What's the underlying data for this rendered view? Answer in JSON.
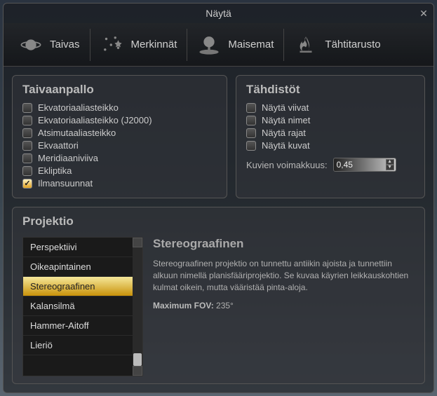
{
  "title": "Näytä",
  "tabs": [
    {
      "label": "Taivas"
    },
    {
      "label": "Merkinnät"
    },
    {
      "label": "Maisemat"
    },
    {
      "label": "Tähtitarusto"
    }
  ],
  "sky": {
    "title": "Taivaanpallo",
    "items": [
      {
        "label": "Ekvatoriaaliasteikko",
        "checked": false
      },
      {
        "label": "Ekvatoriaaliasteikko (J2000)",
        "checked": false
      },
      {
        "label": "Atsimutaaliasteikko",
        "checked": false
      },
      {
        "label": "Ekvaattori",
        "checked": false
      },
      {
        "label": "Meridiaaniviiva",
        "checked": false
      },
      {
        "label": "Ekliptika",
        "checked": false
      },
      {
        "label": "Ilmansuunnat",
        "checked": true
      }
    ]
  },
  "constellations": {
    "title": "Tähdistöt",
    "items": [
      {
        "label": "Näytä viivat",
        "checked": false
      },
      {
        "label": "Näytä nimet",
        "checked": false
      },
      {
        "label": "Näytä rajat",
        "checked": false
      },
      {
        "label": "Näytä kuvat",
        "checked": false
      }
    ],
    "brightness_label": "Kuvien voimakkuus:",
    "brightness_value": "0,45"
  },
  "projection": {
    "title": "Projektio",
    "items": [
      "Perspektiivi",
      "Oikeapintainen",
      "Stereograafinen",
      "Kalansilmä",
      "Hammer-Aitoff",
      "Lieriö"
    ],
    "selected_index": 2,
    "desc_title": "Stereograafinen",
    "desc_body": "Stereograafinen projektio on tunnettu antiikin ajoista ja tunnettiin alkuun nimellä planisfääriprojektio. Se kuvaa käyrien leikkauskohtien kulmat oikein, mutta vääristää pinta-aloja.",
    "fov_label": "Maximum FOV:",
    "fov_value": "235°"
  }
}
